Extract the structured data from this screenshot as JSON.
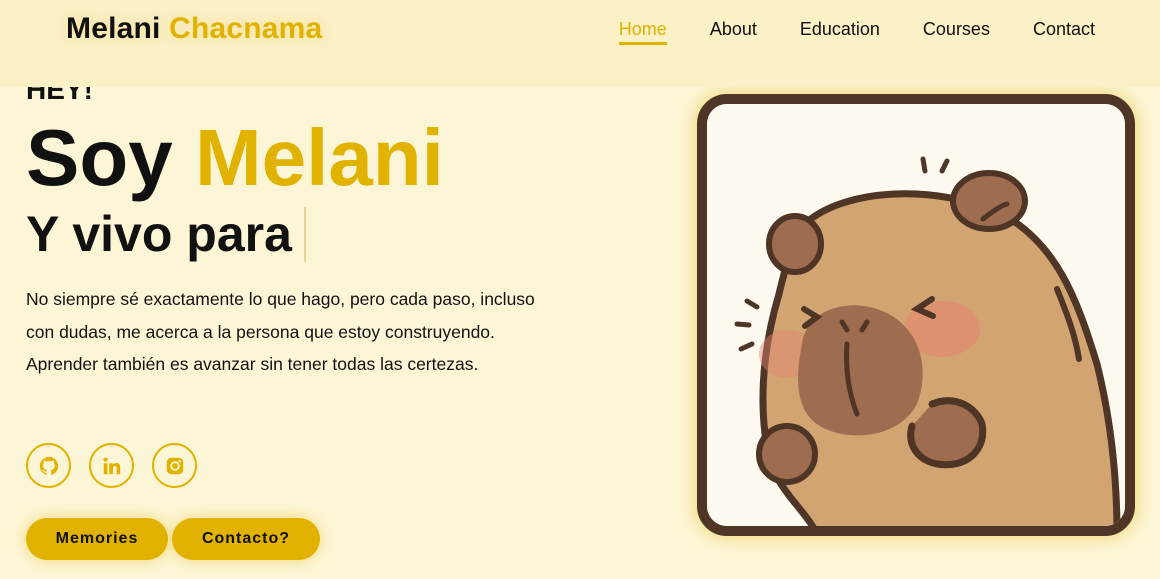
{
  "header": {
    "logo_first": "Melani",
    "logo_last": "Chacnama",
    "nav": [
      {
        "label": "Home",
        "active": true
      },
      {
        "label": "About",
        "active": false
      },
      {
        "label": "Education",
        "active": false
      },
      {
        "label": "Courses",
        "active": false
      },
      {
        "label": "Contact",
        "active": false
      }
    ]
  },
  "hero": {
    "greeting": "HEY!",
    "title_prefix": "Soy",
    "title_name": "Melani",
    "subtitle": "Y vivo para",
    "description": "No siempre sé exactamente lo que hago, pero cada paso, incluso con dudas, me acerca a la persona que estoy construyendo. Aprender también es avanzar sin tener todas las certezas."
  },
  "socials": [
    {
      "icon": "github-icon"
    },
    {
      "icon": "linkedin-icon"
    },
    {
      "icon": "instagram-icon"
    }
  ],
  "buttons": {
    "memories": "Memories",
    "contact": "Contacto?"
  },
  "image": {
    "subject": "capybara-illustration"
  },
  "colors": {
    "accent": "#e2b200",
    "background": "#fdf6d6",
    "header_bg": "#fbf0c6",
    "frame_border": "#4e3526"
  }
}
